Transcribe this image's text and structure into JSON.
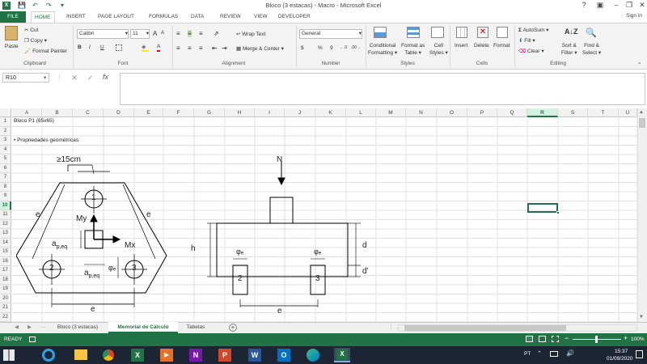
{
  "window": {
    "title": "Bloco (3 estacas) - Macro - Microsoft Excel",
    "help": "?",
    "sign_in": "Sign in"
  },
  "tabs": [
    "FILE",
    "HOME",
    "INSERT",
    "PAGE LAYOUT",
    "FORMULAS",
    "DATA",
    "REVIEW",
    "VIEW",
    "DEVELOPER"
  ],
  "ribbon": {
    "clipboard": {
      "paste": "Paste",
      "cut": "Cut",
      "copy": "Copy",
      "format_painter": "Format Painter",
      "label": "Clipboard"
    },
    "font": {
      "name": "Calibri",
      "size": "11",
      "bold": "B",
      "italic": "I",
      "underline": "U",
      "grow": "A",
      "shrink": "A",
      "font_color": "A",
      "label": "Font"
    },
    "alignment": {
      "wrap": "Wrap Text",
      "merge": "Merge & Center",
      "label": "Alignment"
    },
    "number": {
      "format": "General",
      "currency": "$",
      "percent": "%",
      "comma": "9",
      "label": "Number"
    },
    "styles": {
      "conditional": "Conditional",
      "conditional2": "Formatting",
      "format_as": "Format as",
      "table": "Table",
      "cell": "Cell",
      "cell_styles": "Styles",
      "label": "Styles"
    },
    "cells": {
      "insert": "Insert",
      "delete": "Delete",
      "format": "Format",
      "label": "Cells"
    },
    "editing": {
      "autosum": "AutoSum",
      "fill": "Fill",
      "clear": "Clear",
      "sort": "Sort &",
      "filter": "Filter",
      "find": "Find &",
      "select": "Select",
      "label": "Editing"
    }
  },
  "formula_bar": {
    "name_box": "R10",
    "fx": "fx",
    "cancel": "✕",
    "enter": "✓",
    "value": ""
  },
  "columns": [
    "A",
    "B",
    "C",
    "D",
    "E",
    "F",
    "G",
    "H",
    "I",
    "J",
    "K",
    "L",
    "M",
    "N",
    "O",
    "P",
    "Q",
    "R",
    "S",
    "T",
    "U"
  ],
  "rows": [
    "1",
    "2",
    "3",
    "4",
    "5",
    "6",
    "7",
    "8",
    "9",
    "10",
    "11",
    "12",
    "13",
    "14",
    "15",
    "16",
    "17",
    "18",
    "19",
    "20",
    "21",
    "22"
  ],
  "cells": {
    "a1": "Bloco P1 (65x65)",
    "a3": "• Propriedades geométricas:"
  },
  "drawing": {
    "label_15cm": "≥15cm",
    "pile1": "1",
    "pile2": "2",
    "pile3": "3",
    "e_left": "e",
    "e_right": "e",
    "e_bottom": "e",
    "my": "My",
    "mx": "Mx",
    "ap_eq_v": "a",
    "ap_eq_v_sub": "p,eq",
    "ap_eq_h": "a",
    "ap_eq_h_sub": "p,eq",
    "phi_e": "φₑ",
    "n": "N",
    "h": "h",
    "d": "d",
    "d_prime": "d'",
    "phi_e_left": "φₑ",
    "phi_e_right": "φₑ",
    "e_section": "e",
    "sec_pile_left": "2",
    "sec_pile_right": "3"
  },
  "sheet_tabs": [
    "Bloco (3 estacas)",
    "Memorial de Cálculo",
    "Tabelas"
  ],
  "active_sheet": "Memorial de Cálculo",
  "status": {
    "ready": "READY",
    "zoom": "100%"
  },
  "taskbar": {
    "lang": "PT",
    "time": "15:37",
    "date": "01/09/2020"
  },
  "colors": {
    "excel_green": "#217346",
    "selection": "#217346"
  }
}
